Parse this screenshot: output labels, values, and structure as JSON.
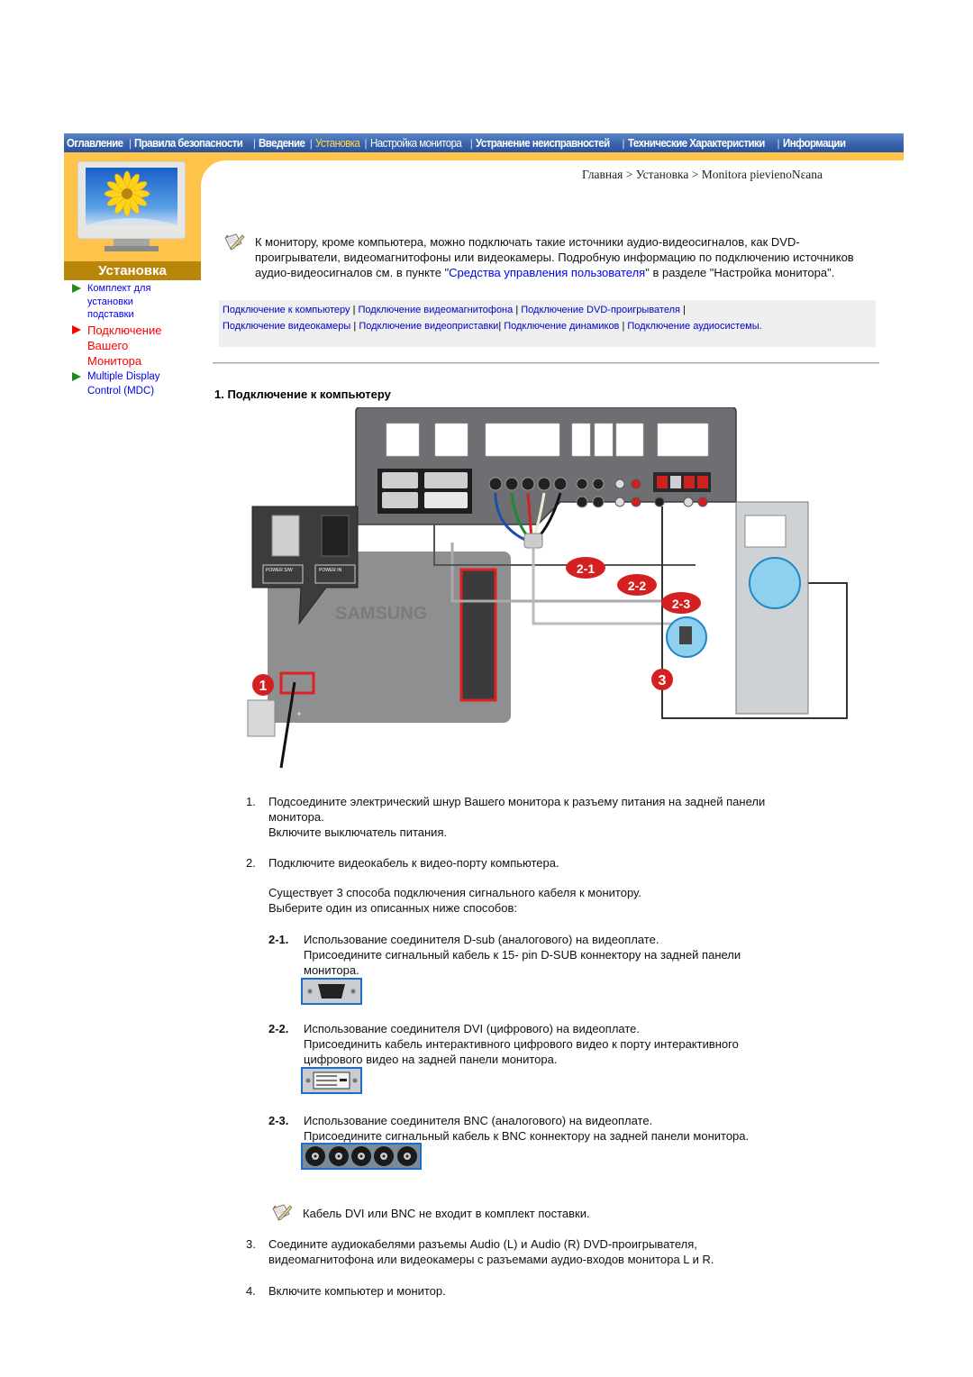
{
  "topnav": {
    "items": [
      {
        "label": "Оглавление",
        "active": false
      },
      {
        "label": "Правила безопасности",
        "active": false
      },
      {
        "label": "Введение",
        "active": false
      },
      {
        "label": "Установка",
        "active": true
      },
      {
        "label": "Настройка монитора",
        "active": false
      },
      {
        "label": "Устранение неисправностей",
        "active": false
      },
      {
        "label": "Технические Характеристики",
        "active": false
      },
      {
        "label": "Информации",
        "active": false
      }
    ],
    "colors": {
      "bar": "#3a64ad",
      "active": "#ffd84a",
      "band": "#ffc24b"
    }
  },
  "sidebar": {
    "section_title": "Установка",
    "items": [
      {
        "label": "Комплект для установки подставки",
        "lines": [
          "Комплект для",
          "установки",
          "подставки"
        ],
        "current": false
      },
      {
        "label": "Подключение Вашего Монитора",
        "lines": [
          "Подключение",
          "Вашего",
          "Монитора"
        ],
        "current": true
      },
      {
        "label": "Multiple Display Control (MDC)",
        "lines": [
          "Multiple Display",
          "Control (MDC)"
        ],
        "current": false
      }
    ]
  },
  "breadcrumb": {
    "text": "Главная > Установка > Monitora pievienoNεana"
  },
  "intro": {
    "text_before": "К монитору, кроме компьютера, можно подключать такие источники аудио-видеосигналов, как DVD-проигрыватели, видеомагнитофоны или видеокамеры. Подробную информацию по подключению источников аудио-видеосигналов см. в пункте \"",
    "link": "Средства управления пользователя",
    "text_after": "\" в разделе \"Настройка монитора\"."
  },
  "links": {
    "items": [
      "Подключение к компьютеру",
      "Подключение видеомагнитофона",
      "Подключение DVD-проигрывателя",
      "Подключение видеокамеры",
      "Подключение видеоприставки",
      "Подключение динамиков",
      "Подключение аудиосистемы."
    ],
    "separator": "|"
  },
  "section": {
    "heading": "1. Подключение к компьютеру"
  },
  "diagram": {
    "callouts": [
      "1",
      "2-1",
      "2-2",
      "2-3",
      "3"
    ],
    "panel_labels": [
      "POWER S/W",
      "POWER IN"
    ],
    "brand": "SAMSUNG"
  },
  "steps": {
    "s1": {
      "num": "1.",
      "line1": "Подсоедините электрический шнур Вашего монитора к разъему питания на задней панели",
      "line2": "монитора.",
      "line3": "Включите выключатель питания."
    },
    "s2": {
      "num": "2.",
      "line1": "Подключите видеокабель к видео-порту компьютера.",
      "line2": "Существует 3 способа подключения сигнального кабеля к монитору.",
      "line3": "Выберите один из описанных ниже способов:"
    },
    "s21": {
      "num": "2-1.",
      "line1": "Использование соединителя D-sub (аналогового) на видеоплате.",
      "line2": "Присоедините сигнальный кабель к 15- pin D-SUB коннектору на задней панели",
      "line3": "монитора."
    },
    "s22": {
      "num": "2-2.",
      "line1": "Использование соединителя DVI (цифрового) на видеоплате.",
      "line2": "Присоединить кабель интерактивного цифрового видео к порту интерактивного",
      "line3": "цифрового видео на задней панели монитора."
    },
    "s23": {
      "num": "2-3.",
      "line1": "Использование соединителя BNC (аналогового) на видеоплате.",
      "line2": "Присоедините сигнальный кабель к BNC коннектору на задней панели монитора."
    },
    "note": "Кабель DVI или BNC не входит в комплект поставки.",
    "s3": {
      "num": "3.",
      "line1": "Соедините аудиокабелями разъемы Audio (L) и Audio (R) DVD-проигрывателя,",
      "line2": "видеомагнитофона или видеокамеры с разъемами аудио-входов монитора L и R."
    },
    "s4": {
      "num": "4.",
      "line1": "Включите компьютер и монитор."
    }
  }
}
